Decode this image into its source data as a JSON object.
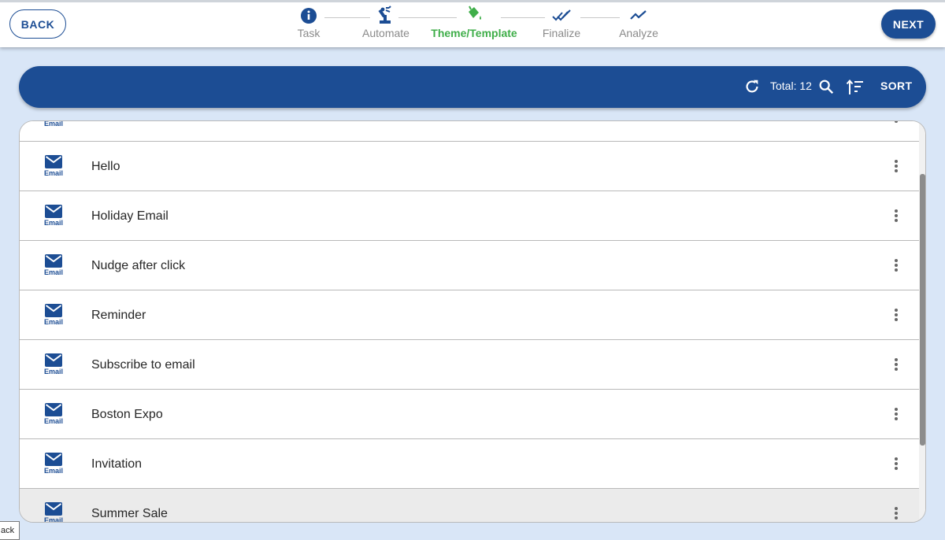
{
  "header": {
    "back_label": "BACK",
    "next_label": "NEXT",
    "steps": [
      {
        "label": "Task",
        "icon": "info-icon",
        "state": "done"
      },
      {
        "label": "Automate",
        "icon": "robot-arm-icon",
        "state": "done"
      },
      {
        "label": "Theme/Template",
        "icon": "paint-bucket-icon",
        "state": "active"
      },
      {
        "label": "Finalize",
        "icon": "double-check-icon",
        "state": "pending"
      },
      {
        "label": "Analyze",
        "icon": "trend-line-icon",
        "state": "pending"
      }
    ]
  },
  "toolbar": {
    "total_label": "Total: 12",
    "sort_label": "SORT"
  },
  "templates": [
    {
      "type": "Email",
      "name": ""
    },
    {
      "type": "Email",
      "name": "Hello"
    },
    {
      "type": "Email",
      "name": "Holiday Email"
    },
    {
      "type": "Email",
      "name": "Nudge after click"
    },
    {
      "type": "Email",
      "name": "Reminder"
    },
    {
      "type": "Email",
      "name": "Subscribe to email"
    },
    {
      "type": "Email",
      "name": "Boston Expo"
    },
    {
      "type": "Email",
      "name": "Invitation"
    },
    {
      "type": "Email",
      "name": "Summer Sale"
    }
  ],
  "tooltip": "ack",
  "colors": {
    "primary": "#1c4d94",
    "active_step": "#3fae49",
    "background": "#d9e6f7"
  }
}
